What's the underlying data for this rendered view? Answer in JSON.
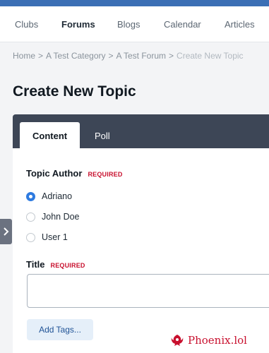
{
  "nav": {
    "items": [
      {
        "label": "Clubs"
      },
      {
        "label": "Forums"
      },
      {
        "label": "Blogs"
      },
      {
        "label": "Calendar"
      },
      {
        "label": "Articles"
      }
    ],
    "active": "Forums"
  },
  "breadcrumb": {
    "items": [
      "Home",
      "A Test Category",
      "A Test Forum",
      "Create New Topic"
    ],
    "separator": ">"
  },
  "page": {
    "title": "Create New Topic"
  },
  "tabs": [
    {
      "label": "Content",
      "active": true
    },
    {
      "label": "Poll",
      "active": false
    }
  ],
  "form": {
    "topic_author": {
      "label": "Topic Author",
      "required": "REQUIRED",
      "options": [
        {
          "label": "Adriano",
          "checked": true
        },
        {
          "label": "John Doe",
          "checked": false
        },
        {
          "label": "User 1",
          "checked": false
        }
      ]
    },
    "title": {
      "label": "Title",
      "required": "REQUIRED",
      "value": ""
    },
    "add_tags": {
      "label": "Add Tags..."
    }
  },
  "watermark": {
    "text": "Phoenix.lol"
  },
  "colors": {
    "accent": "#3b6fb5",
    "tabbar": "#3d4656",
    "required": "#c8102e",
    "radio_checked": "#2e7be0",
    "tags_button_bg": "#e5eff9"
  }
}
